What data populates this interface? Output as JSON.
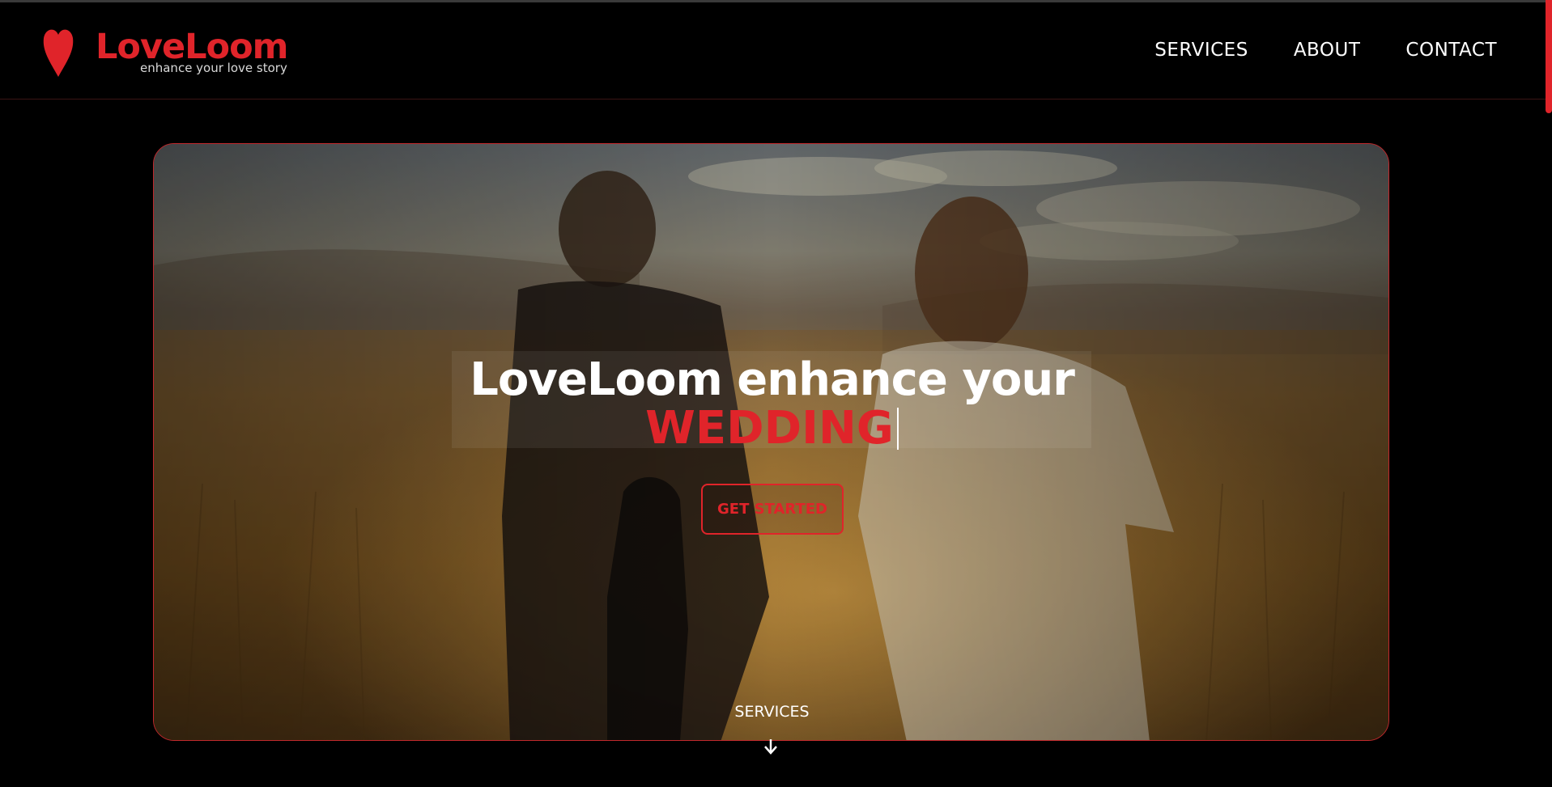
{
  "brand": {
    "name": "LoveLoom",
    "tagline": "enhance your love story",
    "accent_color": "#e0242a",
    "logo_icon": "heart-icon"
  },
  "nav": {
    "items": [
      {
        "label": "SERVICES"
      },
      {
        "label": "ABOUT"
      },
      {
        "label": "CONTACT"
      }
    ]
  },
  "hero": {
    "headline": "LoveLoom enhance your",
    "headline_accent": "WEDDING",
    "cta_label": "GET STARTED",
    "scroll_label": "SERVICES",
    "scroll_icon": "arrow-down-icon"
  }
}
